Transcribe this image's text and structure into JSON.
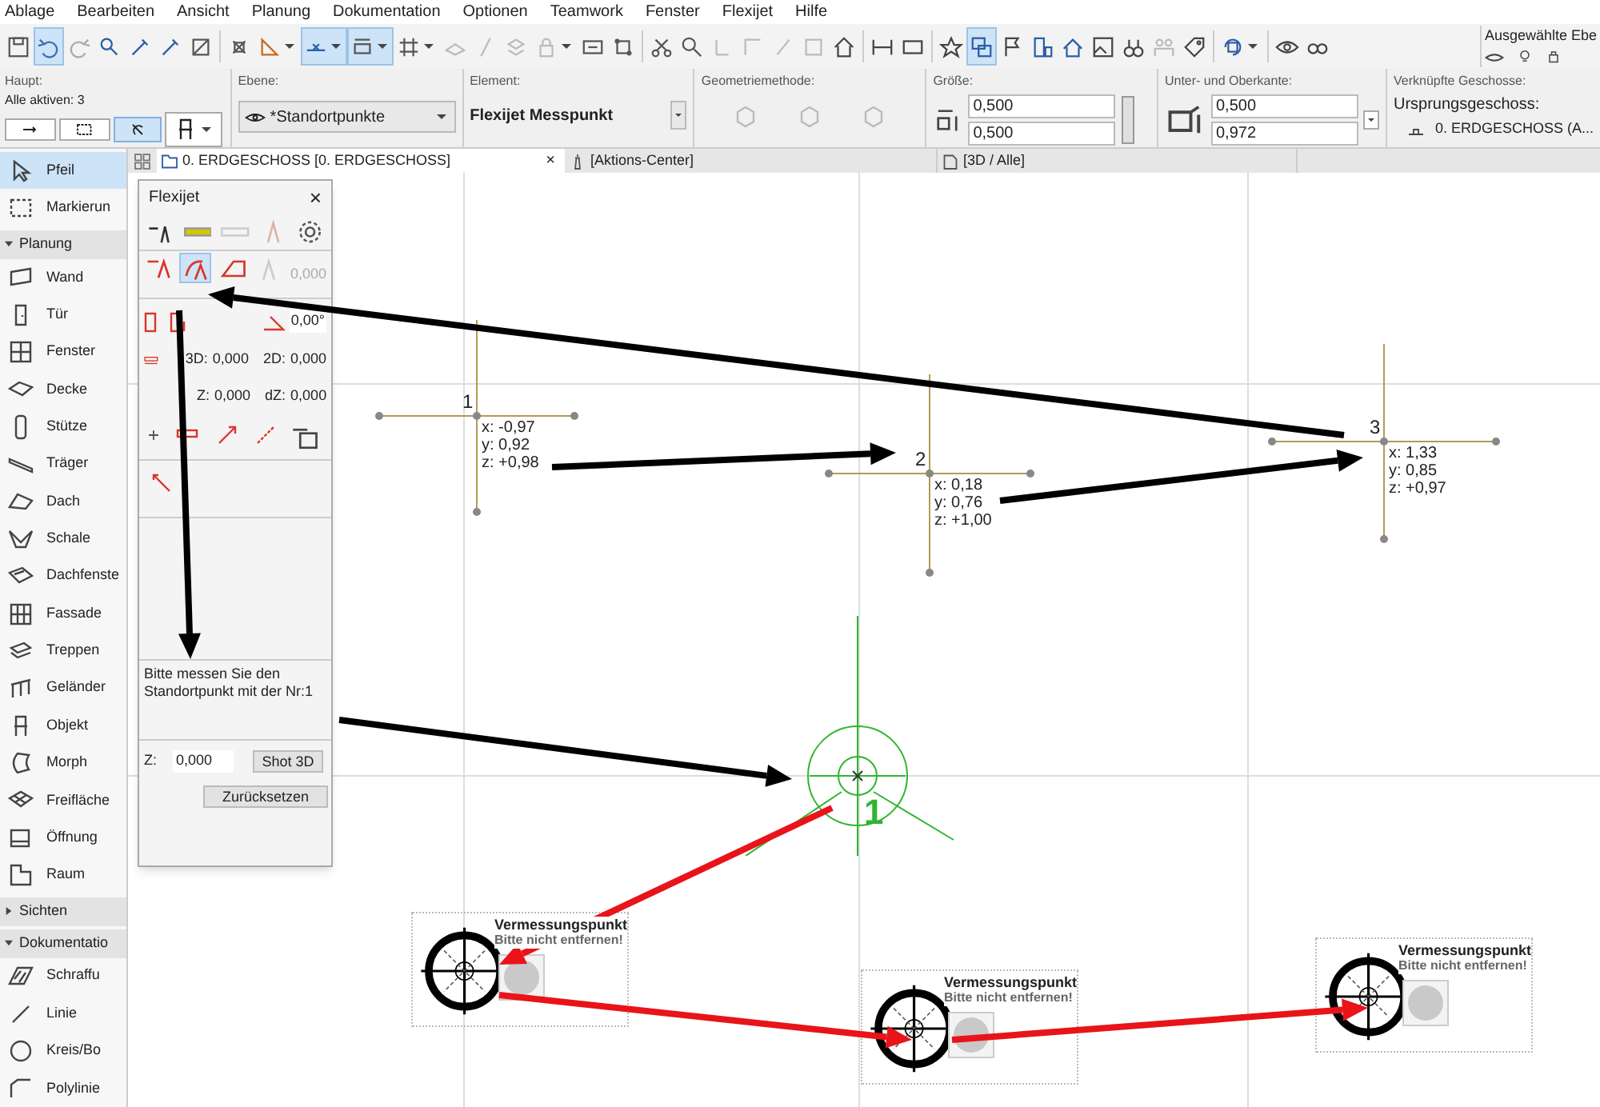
{
  "menu": [
    "Ablage",
    "Bearbeiten",
    "Ansicht",
    "Planung",
    "Dokumentation",
    "Optionen",
    "Teamwork",
    "Fenster",
    "Flexijet",
    "Hilfe"
  ],
  "toolbar": {
    "buttons": [
      {
        "pressed": false
      },
      {
        "pressed": true
      },
      {
        "pressed": false
      },
      {
        "pressed": false
      },
      {
        "pressed": false
      },
      {
        "pressed": false
      },
      {
        "pressed": false
      },
      {
        "pressed": false
      },
      {
        "pressed": false
      },
      {
        "pressed": true
      },
      {
        "pressed": true
      },
      {
        "pressed": false
      },
      {
        "pressed": false
      },
      {
        "pressed": false
      },
      {
        "pressed": false
      },
      {
        "pressed": false
      },
      {
        "pressed": false
      },
      {
        "pressed": false
      },
      {
        "pressed": false
      },
      {
        "pressed": false
      },
      {
        "pressed": false
      },
      {
        "pressed": false
      },
      {
        "pressed": false
      },
      {
        "pressed": false
      },
      {
        "pressed": false
      },
      {
        "pressed": false
      },
      {
        "pressed": false
      },
      {
        "pressed": false
      },
      {
        "pressed": true
      },
      {
        "pressed": false
      },
      {
        "pressed": false
      },
      {
        "pressed": false
      },
      {
        "pressed": false
      },
      {
        "pressed": false
      },
      {
        "pressed": false
      },
      {
        "pressed": false
      },
      {
        "pressed": false
      },
      {
        "pressed": false
      },
      {
        "pressed": false
      }
    ],
    "layer_label": "Ausgewählte Ebe"
  },
  "info_box": {
    "main": {
      "label": "Haupt:",
      "active": "Alle aktiven: 3"
    },
    "layer": {
      "label": "Ebene:",
      "value": "*Standortpunkte"
    },
    "element": {
      "label": "Element:",
      "value": "Flexijet Messpunkt"
    },
    "geometry": {
      "label": "Geometriemethode:"
    },
    "size": {
      "label": "Größe:",
      "values": [
        "0,500",
        "0,500"
      ]
    },
    "edges": {
      "label": "Unter- und Oberkante:",
      "values": [
        "0,500",
        "0,972"
      ]
    },
    "stories": {
      "label": "Verknüpfte Geschosse:",
      "heading": "Ursprungsgeschoss:",
      "value": "0. ERDGESCHOSS (A..."
    }
  },
  "tabs": [
    {
      "label": "0. ERDGESCHOSS [0. ERDGESCHOSS]",
      "selected": true,
      "close": "×"
    },
    {
      "label": "[Aktions-Center]",
      "selected": false
    },
    {
      "label": "[3D / Alle]",
      "selected": false
    }
  ],
  "toolbox": [
    {
      "kind": "tool",
      "label": "Pfeil",
      "selected": true
    },
    {
      "kind": "tool",
      "label": "Markierun",
      "selected": false
    },
    {
      "kind": "section",
      "label": "Planung",
      "expanded": true
    },
    {
      "kind": "tool",
      "label": "Wand",
      "selected": false
    },
    {
      "kind": "tool",
      "label": "Tür",
      "selected": false
    },
    {
      "kind": "tool",
      "label": "Fenster",
      "selected": false
    },
    {
      "kind": "tool",
      "label": "Decke",
      "selected": false
    },
    {
      "kind": "tool",
      "label": "Stütze",
      "selected": false
    },
    {
      "kind": "tool",
      "label": "Träger",
      "selected": false
    },
    {
      "kind": "tool",
      "label": "Dach",
      "selected": false
    },
    {
      "kind": "tool",
      "label": "Schale",
      "selected": false
    },
    {
      "kind": "tool",
      "label": "Dachfenste",
      "selected": false
    },
    {
      "kind": "tool",
      "label": "Fassade",
      "selected": false
    },
    {
      "kind": "tool",
      "label": "Treppen",
      "selected": false
    },
    {
      "kind": "tool",
      "label": "Geländer",
      "selected": false
    },
    {
      "kind": "tool",
      "label": "Objekt",
      "selected": false
    },
    {
      "kind": "tool",
      "label": "Morph",
      "selected": false
    },
    {
      "kind": "tool",
      "label": "Freifläche",
      "selected": false
    },
    {
      "kind": "tool",
      "label": "Öffnung",
      "selected": false
    },
    {
      "kind": "tool",
      "label": "Raum",
      "selected": false
    },
    {
      "kind": "section",
      "label": "Sichten",
      "expanded": false
    },
    {
      "kind": "section",
      "label": "Dokumentatio",
      "expanded": true
    },
    {
      "kind": "tool",
      "label": "Schraffu",
      "selected": false
    },
    {
      "kind": "tool",
      "label": "Linie",
      "selected": false
    },
    {
      "kind": "tool",
      "label": "Kreis/Bo",
      "selected": false
    },
    {
      "kind": "tool",
      "label": "Polylinie",
      "selected": false
    }
  ],
  "flexijet_panel": {
    "title": "Flexijet",
    "close": "×",
    "mode_buttons": [
      {
        "selected": false
      },
      {
        "selected": true
      },
      {
        "selected": false
      },
      {
        "selected": false
      }
    ],
    "mode_value": "0,000",
    "angle": "0,00°",
    "measures": [
      {
        "label": "3D:",
        "value": "0,000"
      },
      {
        "label": "2D:",
        "value": "0,000"
      },
      {
        "label": "Z:",
        "value": "0,000"
      },
      {
        "label": "dZ:",
        "value": "0,000"
      }
    ],
    "message": "Bitte messen Sie den Standortpunkt mit der Nr:1",
    "z_label": "Z:",
    "z_value": "0,000",
    "shot_button": "Shot 3D",
    "reset_button": "Zurücksetzen"
  },
  "canvas": {
    "points": [
      {
        "number": "1",
        "coords": [
          "x: -0,97",
          "y: 0,92",
          "z: +0,98"
        ]
      },
      {
        "number": "2",
        "coords": [
          "x: 0,18",
          "y: 0,76",
          "z: +1,00"
        ]
      },
      {
        "number": "3",
        "coords": [
          "x: 1,33",
          "y: 0,85",
          "z: +0,97"
        ]
      }
    ],
    "station": {
      "number": "1"
    },
    "markers": [
      {
        "title": "Vermessungspunkt",
        "subtitle": "Bitte nicht entfernen!"
      },
      {
        "title": "Vermessungspunkt",
        "subtitle": "Bitte nicht entfernen!"
      },
      {
        "title": "Vermessungspunkt",
        "subtitle": "Bitte nicht entfernen!"
      }
    ]
  }
}
